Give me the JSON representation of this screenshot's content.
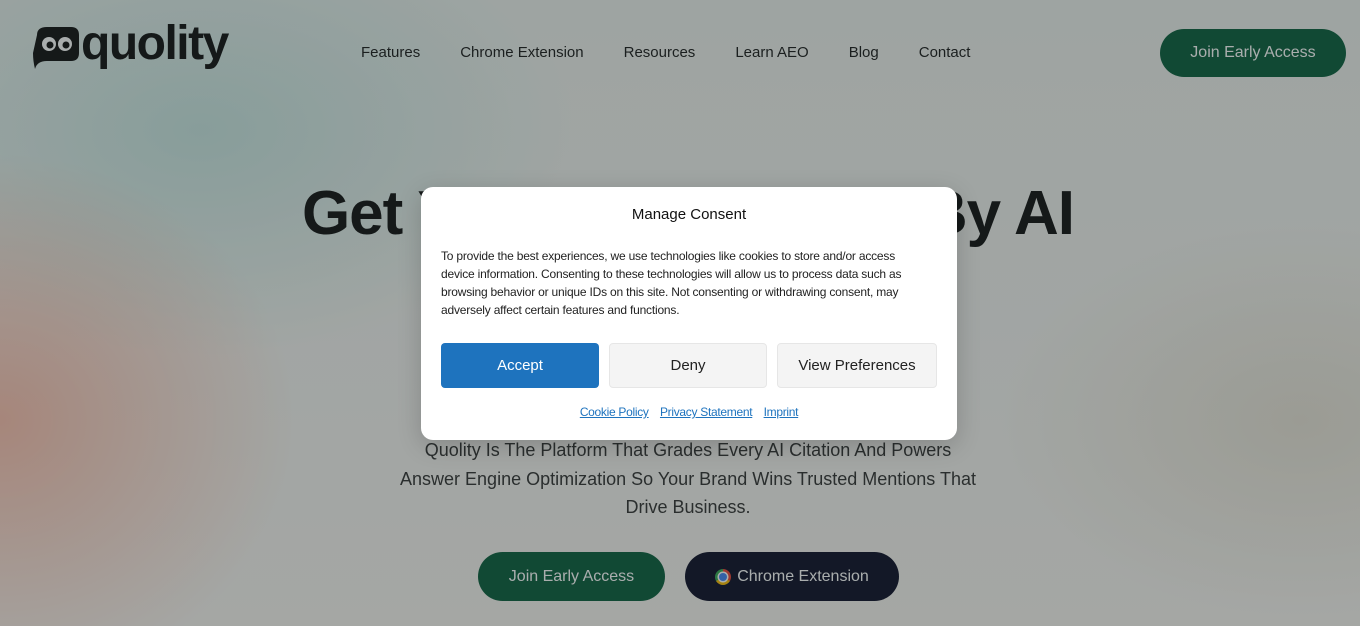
{
  "header": {
    "brand": "quolity",
    "nav": [
      "Features",
      "Chrome Extension",
      "Resources",
      "Learn AEO",
      "Blog",
      "Contact"
    ],
    "cta_label": "Join Early Access"
  },
  "hero": {
    "title": "Get Your Brand Cited By AI",
    "subtitle": "Quolity Is The Platform That Grades Every AI Citation And Powers Answer Engine Optimization So Your Brand Wins Trusted Mentions That Drive Business.",
    "primary_cta": "Join Early Access",
    "secondary_cta": "Chrome Extension"
  },
  "consent": {
    "title": "Manage Consent",
    "body": "To provide the best experiences, we use technologies like cookies to store and/or access device information. Consenting to these technologies will allow us to process data such as browsing behavior or unique IDs on this site. Not consenting or withdrawing consent, may adversely affect certain features and functions.",
    "accept_label": "Accept",
    "deny_label": "Deny",
    "preferences_label": "View Preferences",
    "links": [
      "Cookie Policy",
      "Privacy Statement",
      "Imprint"
    ]
  },
  "colors": {
    "brand_green": "#0b5e3c",
    "dark_navy": "#0d1027",
    "accept_blue": "#1e73be"
  }
}
